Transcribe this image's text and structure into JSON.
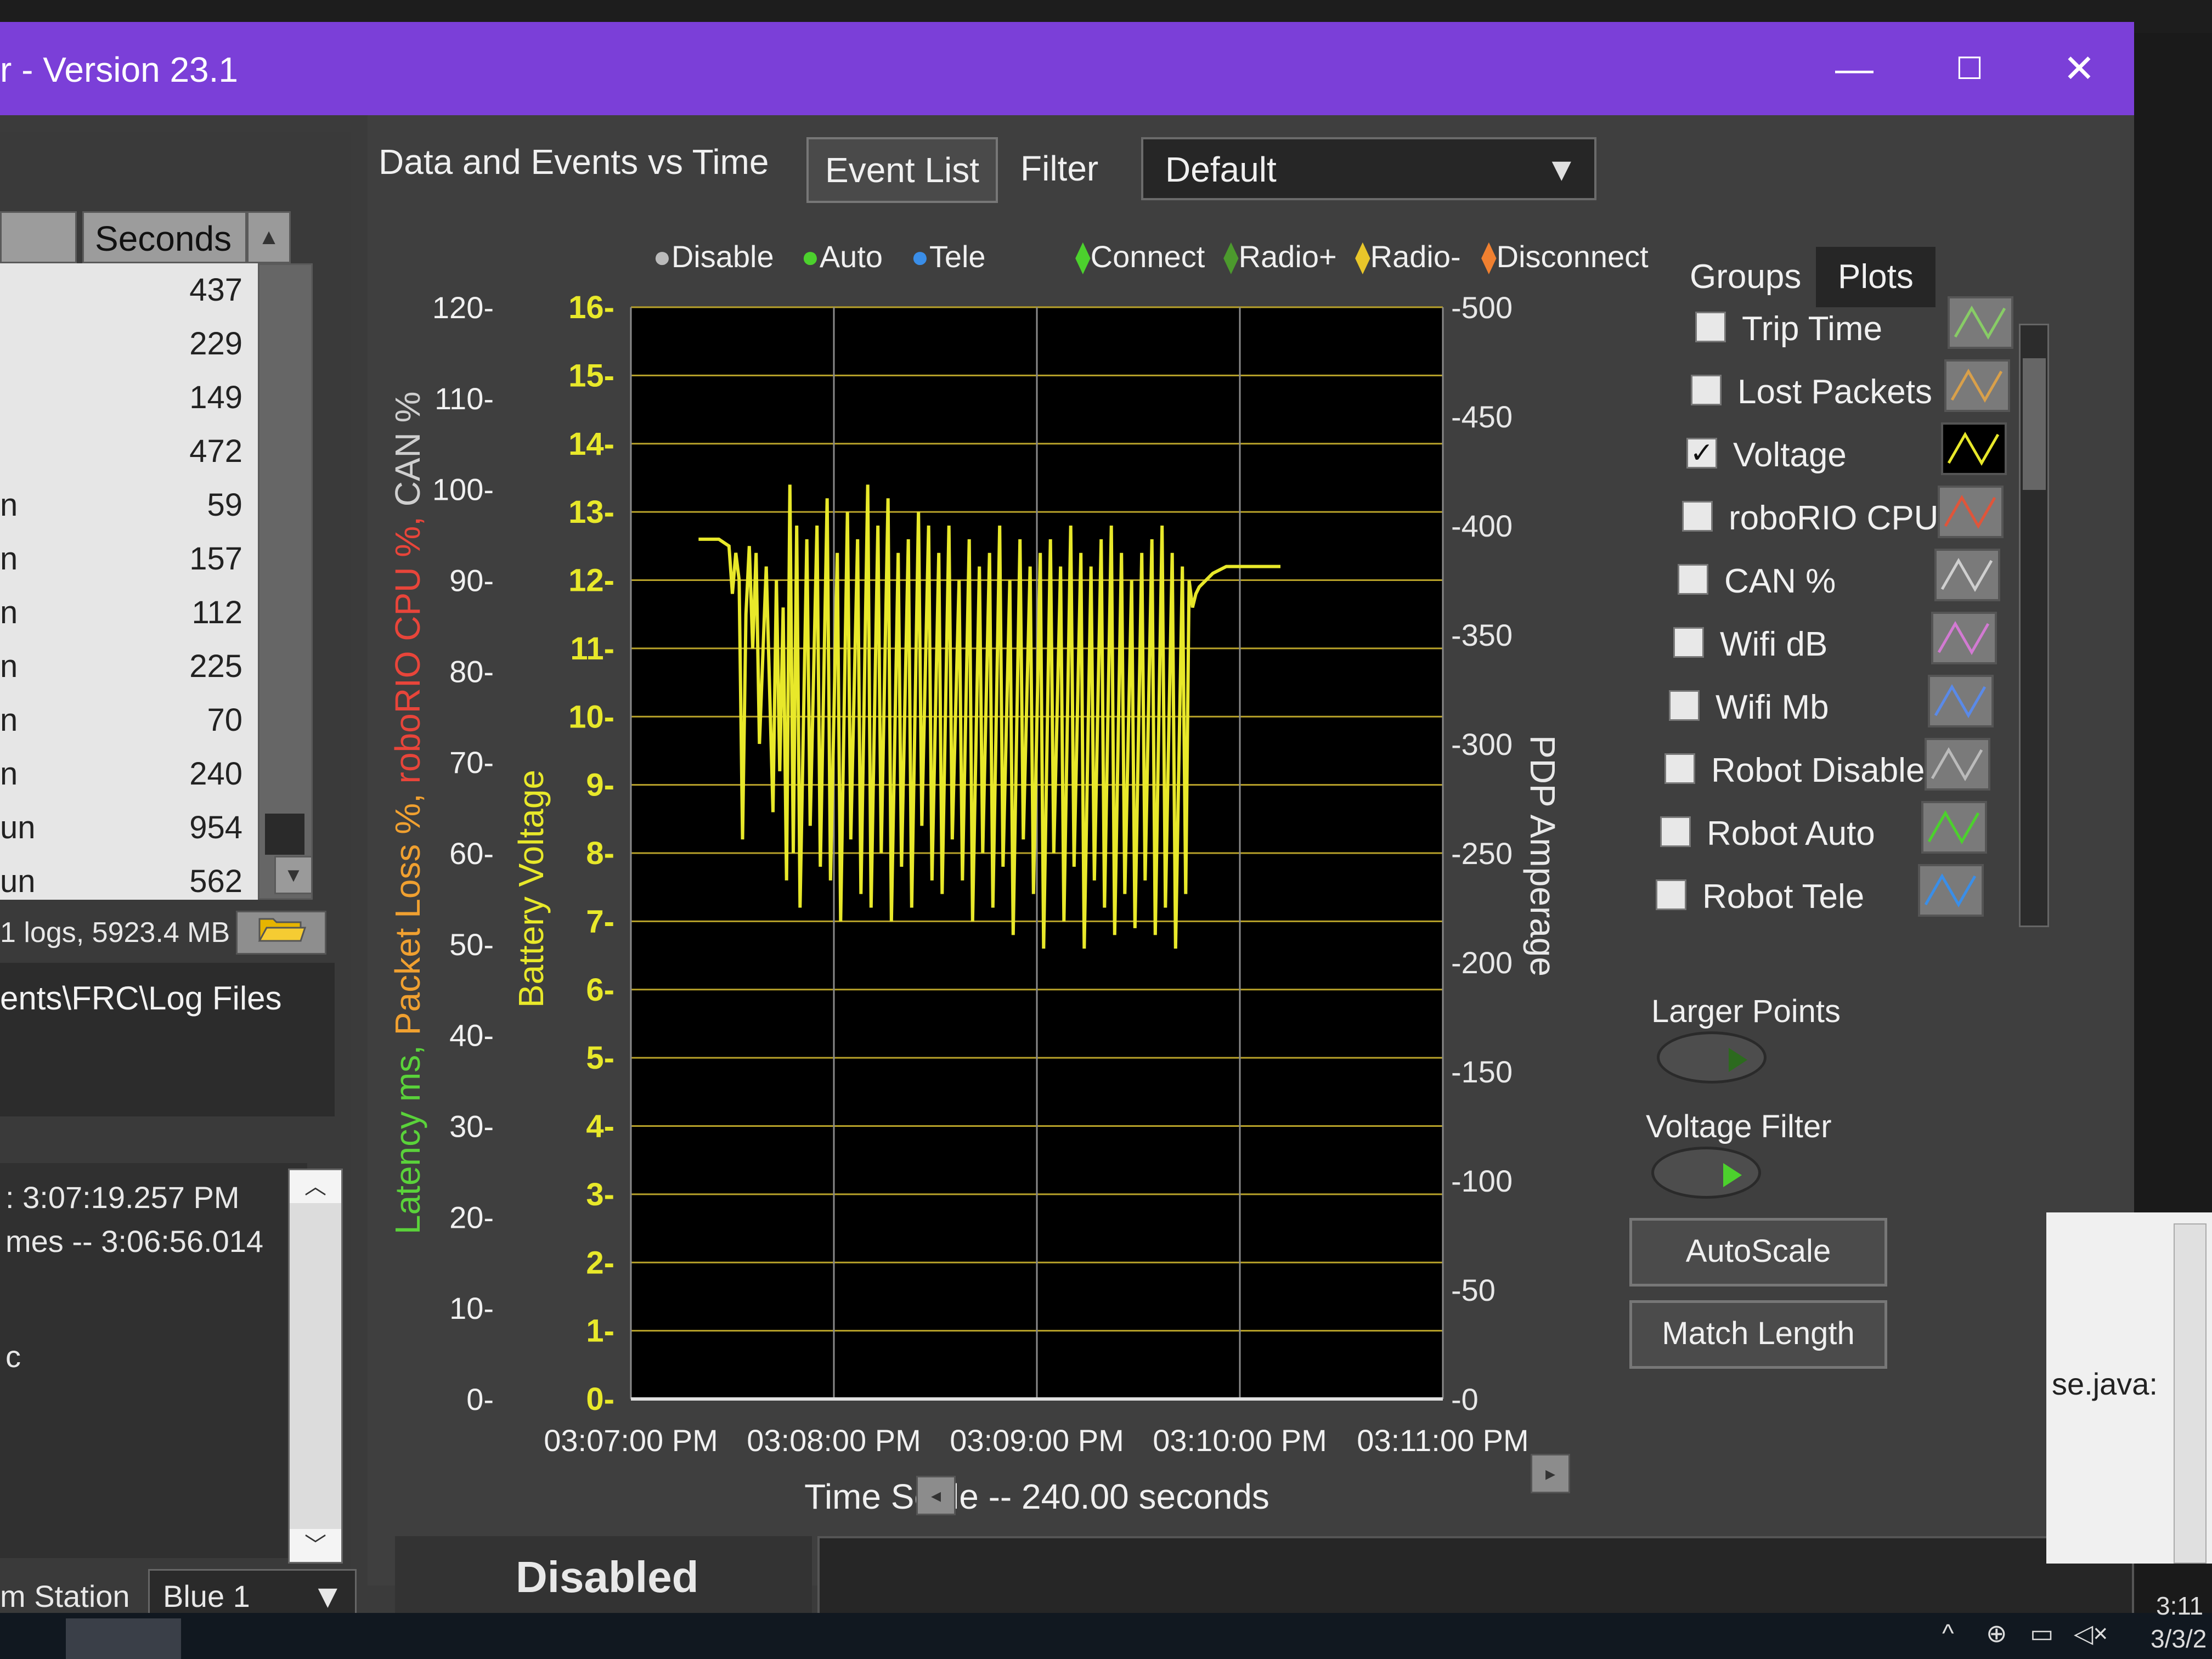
{
  "window": {
    "title": "r - Version 23.1",
    "minimize_glyph": "—",
    "maximize_glyph": "☐",
    "close_glyph": "✕"
  },
  "log_list": {
    "column_header": "Seconds",
    "rows": [
      {
        "prefix": "",
        "value": "437"
      },
      {
        "prefix": "",
        "value": "229"
      },
      {
        "prefix": "",
        "value": "149"
      },
      {
        "prefix": "",
        "value": "472"
      },
      {
        "prefix": "n",
        "value": "59"
      },
      {
        "prefix": "n",
        "value": "157"
      },
      {
        "prefix": "n",
        "value": "112"
      },
      {
        "prefix": "n",
        "value": "225"
      },
      {
        "prefix": "n",
        "value": "70"
      },
      {
        "prefix": "n",
        "value": "240"
      },
      {
        "prefix": "un",
        "value": "954"
      },
      {
        "prefix": "un",
        "value": "562"
      }
    ],
    "summary": "1 logs, 5923.4 MB",
    "folder_icon": "folder-open-icon"
  },
  "log_path": "ents\\FRC\\Log Files",
  "event_log": {
    "lines": [
      ": 3:07:19.257 PM",
      "mes --  3:06:56.014",
      "",
      "c"
    ]
  },
  "station": {
    "label": "m Station",
    "selected": "Blue 1"
  },
  "tabs": {
    "data_events": "Data and Events vs Time",
    "event_list": "Event List",
    "filter_label": "Filter",
    "filter_value": "Default"
  },
  "legend": {
    "disable": "Disable",
    "auto": "Auto",
    "tele": "Tele",
    "connect": "Connect",
    "radio_plus": "Radio+",
    "radio_minus": "Radio-",
    "disconnect": "Disconnect"
  },
  "side_tabs": {
    "groups": "Groups",
    "plots": "Plots"
  },
  "plots": [
    {
      "label": "Trip Time",
      "checked": false,
      "swatch": "#88cc66"
    },
    {
      "label": "Lost Packets",
      "checked": false,
      "swatch": "#d9a04a"
    },
    {
      "label": "Voltage",
      "checked": true,
      "swatch": "#e8e82a"
    },
    {
      "label": "roboRIO CPU %",
      "checked": false,
      "swatch": "#e0553a"
    },
    {
      "label": "CAN %",
      "checked": false,
      "swatch": "#cfcfcf"
    },
    {
      "label": "Wifi dB",
      "checked": false,
      "swatch": "#d27ad2"
    },
    {
      "label": "Wifi Mb",
      "checked": false,
      "swatch": "#5a8ae8"
    },
    {
      "label": "Robot Disable",
      "checked": false,
      "swatch": "#bbbbbb"
    },
    {
      "label": "Robot Auto",
      "checked": false,
      "swatch": "#4cd12d"
    },
    {
      "label": "Robot Tele",
      "checked": false,
      "swatch": "#3a8ee8"
    }
  ],
  "checkmark": "✓",
  "controls": {
    "larger_points": "Larger Points",
    "voltage_filter": "Voltage Filter",
    "autoscale": "AutoScale",
    "match_length": "Match Length"
  },
  "status": {
    "mode": "Disabled"
  },
  "external": {
    "text": "se.java:"
  },
  "tray": {
    "time": "3:11",
    "date": "3/3/2"
  },
  "colors": {
    "title_bar": "#7b3fd8",
    "voltage_trace": "#e8e82a",
    "latency_axis": "#5ad23a",
    "packet_axis": "#f0a030",
    "cpu_axis": "#e8453a",
    "can_axis": "#cfcfcf",
    "voltage_axis": "#e8e82a",
    "amperage_axis": "#e8e8e8"
  },
  "chart_data": {
    "type": "line",
    "xlabel": "Time Scale -- 240.00 seconds",
    "x_ticks": [
      "03:07:00 PM",
      "03:08:00 PM",
      "03:09:00 PM",
      "03:10:00 PM",
      "03:11:00 PM"
    ],
    "axis_left_outer": {
      "label_parts": [
        "Latency ms,",
        "Packet Loss %,",
        "roboRIO CPU %,",
        "CAN %"
      ],
      "range": [
        0,
        120
      ],
      "ticks": [
        "0-",
        "10-",
        "20-",
        "30-",
        "40-",
        "50-",
        "60-",
        "70-",
        "80-",
        "90-",
        "100-",
        "110-",
        "120-"
      ]
    },
    "axis_left_inner": {
      "label": "Battery Voltage",
      "range": [
        0,
        16
      ],
      "ticks": [
        "0-",
        "1-",
        "2-",
        "3-",
        "4-",
        "5-",
        "6-",
        "7-",
        "8-",
        "9-",
        "10-",
        "11-",
        "12-",
        "13-",
        "14-",
        "15-",
        "16-"
      ]
    },
    "axis_right": {
      "label": "PDP Amperage",
      "range": [
        0,
        500
      ],
      "ticks": [
        "-0",
        "-50",
        "-100",
        "-150",
        "-200",
        "-250",
        "-300",
        "-350",
        "-400",
        "-450",
        "-500"
      ]
    },
    "x_range_seconds": [
      0,
      240
    ],
    "series": [
      {
        "name": "Voltage",
        "points": [
          [
            20,
            12.6
          ],
          [
            26,
            12.6
          ],
          [
            29,
            12.5
          ],
          [
            30,
            11.8
          ],
          [
            31,
            12.4
          ],
          [
            32,
            12.0
          ],
          [
            33,
            8.2
          ],
          [
            34,
            11.5
          ],
          [
            35,
            12.5
          ],
          [
            36,
            11.0
          ],
          [
            37,
            12.4
          ],
          [
            38,
            9.6
          ],
          [
            40,
            12.2
          ],
          [
            42,
            8.6
          ],
          [
            43,
            12.0
          ],
          [
            44,
            9.2
          ],
          [
            45,
            11.6
          ],
          [
            46,
            7.6
          ],
          [
            47,
            13.4
          ],
          [
            48,
            8.0
          ],
          [
            49,
            12.8
          ],
          [
            50,
            7.2
          ],
          [
            52,
            12.6
          ],
          [
            53,
            8.4
          ],
          [
            55,
            12.8
          ],
          [
            56,
            7.8
          ],
          [
            58,
            13.2
          ],
          [
            59,
            7.6
          ],
          [
            61,
            12.4
          ],
          [
            62,
            7.0
          ],
          [
            64,
            13.0
          ],
          [
            65,
            8.2
          ],
          [
            67,
            12.6
          ],
          [
            68,
            7.4
          ],
          [
            70,
            13.4
          ],
          [
            71,
            7.2
          ],
          [
            73,
            12.8
          ],
          [
            74,
            8.0
          ],
          [
            76,
            13.2
          ],
          [
            77,
            7.0
          ],
          [
            79,
            12.4
          ],
          [
            80,
            7.8
          ],
          [
            82,
            12.6
          ],
          [
            83,
            7.2
          ],
          [
            85,
            13.0
          ],
          [
            86,
            8.4
          ],
          [
            88,
            12.8
          ],
          [
            89,
            7.6
          ],
          [
            91,
            12.4
          ],
          [
            92,
            7.4
          ],
          [
            94,
            12.8
          ],
          [
            95,
            8.2
          ],
          [
            97,
            12.0
          ],
          [
            98,
            7.6
          ],
          [
            100,
            12.6
          ],
          [
            101,
            7.0
          ],
          [
            103,
            12.2
          ],
          [
            104,
            8.0
          ],
          [
            106,
            12.4
          ],
          [
            107,
            7.2
          ],
          [
            109,
            12.8
          ],
          [
            110,
            7.8
          ],
          [
            112,
            12.0
          ],
          [
            113,
            6.8
          ],
          [
            115,
            12.6
          ],
          [
            116,
            8.2
          ],
          [
            118,
            12.2
          ],
          [
            119,
            7.4
          ],
          [
            121,
            12.4
          ],
          [
            122,
            6.6
          ],
          [
            124,
            12.6
          ],
          [
            125,
            8.0
          ],
          [
            127,
            12.2
          ],
          [
            128,
            7.0
          ],
          [
            130,
            12.8
          ],
          [
            131,
            7.8
          ],
          [
            133,
            12.4
          ],
          [
            134,
            6.6
          ],
          [
            136,
            12.2
          ],
          [
            137,
            7.6
          ],
          [
            139,
            12.6
          ],
          [
            140,
            7.2
          ],
          [
            142,
            12.8
          ],
          [
            143,
            6.8
          ],
          [
            145,
            12.4
          ],
          [
            146,
            7.4
          ],
          [
            148,
            12.0
          ],
          [
            149,
            6.9
          ],
          [
            151,
            12.4
          ],
          [
            152,
            7.6
          ],
          [
            154,
            12.6
          ],
          [
            155,
            6.8
          ],
          [
            157,
            12.8
          ],
          [
            158,
            7.2
          ],
          [
            160,
            12.4
          ],
          [
            161,
            6.6
          ],
          [
            163,
            12.2
          ],
          [
            164,
            7.4
          ],
          [
            165,
            12.0
          ],
          [
            166,
            11.6
          ],
          [
            167,
            11.8
          ],
          [
            168,
            11.9
          ],
          [
            170,
            12.0
          ],
          [
            172,
            12.1
          ],
          [
            176,
            12.2
          ],
          [
            180,
            12.2
          ],
          [
            192,
            12.2
          ]
        ]
      }
    ]
  }
}
